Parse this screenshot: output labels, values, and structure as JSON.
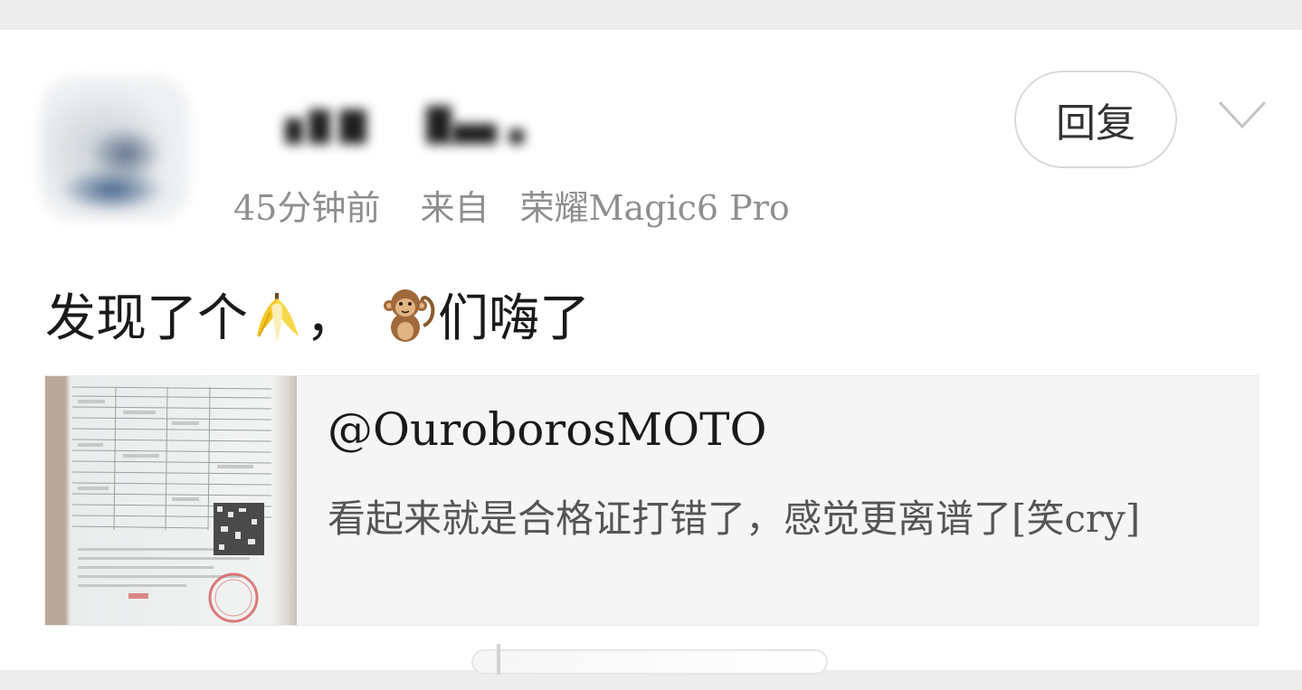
{
  "comment": {
    "time": "45分钟前",
    "source_label": "来自",
    "device": "荣耀Magic6 Pro",
    "text_part1": "发现了个",
    "text_part2": "，",
    "text_part3": "们嗨了",
    "emoji_1": "banana-emoji",
    "emoji_2": "monkey-emoji"
  },
  "actions": {
    "reply_label": "回复"
  },
  "quote": {
    "author": "@OuroborosMOTO",
    "text": "看起来就是合格证打错了，感觉更离谱了[笑cry]"
  }
}
